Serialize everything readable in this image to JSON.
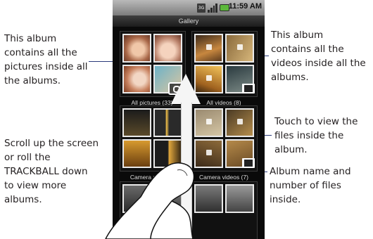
{
  "phone": {
    "time": "11:59 AM",
    "title": "Gallery"
  },
  "albums": [
    {
      "label": "All pictures (33)"
    },
    {
      "label": "All videos (8)"
    },
    {
      "label": "Camera pictures"
    },
    {
      "label": "Camera videos (7)"
    }
  ],
  "callouts": {
    "left_top": "This album contains all the pictures inside all the albums.",
    "left_bottom": "Scroll up the screen or roll the TRACKBALL down to view more albums.",
    "right_top": "This album contains all the videos inside all the albums.",
    "right_mid": "Touch to view the files inside the album.",
    "right_bottom": "Album name and number of files inside."
  },
  "icons": [
    "camera-icon",
    "film-icon",
    "signal-icon",
    "battery-icon",
    "network-icon",
    "up-arrow-icon",
    "hand-icon"
  ]
}
